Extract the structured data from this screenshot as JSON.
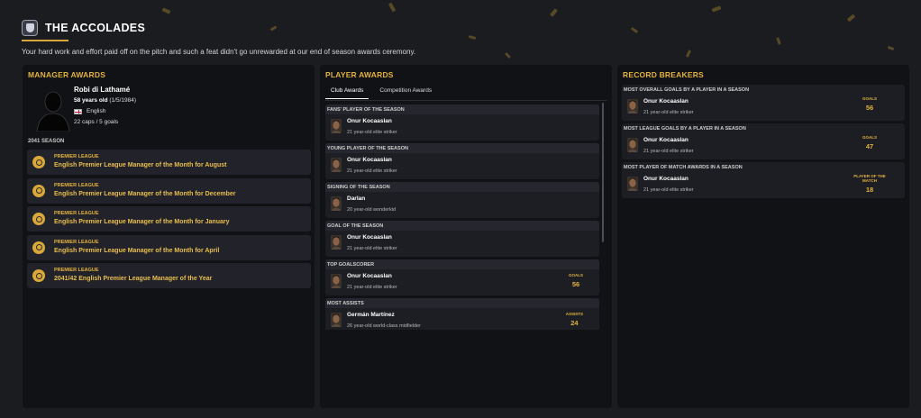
{
  "header": {
    "title": "THE ACCOLADES",
    "subtitle": "Your hard work and effort paid off on the pitch and such a feat didn't go unrewarded at our end of season awards ceremony."
  },
  "colors": {
    "accent": "#e3b33c",
    "panel": "#111216",
    "background": "#1b1c20"
  },
  "manager": {
    "panel_title": "MANAGER AWARDS",
    "name": "Robi di Lathamé",
    "age": "58 years old",
    "dob": "(1/5/1984)",
    "nationality": "English",
    "caps": "22 caps / 5 goals",
    "season": "2041 SEASON",
    "awards": [
      {
        "competition": "PREMIER LEAGUE",
        "name": "English Premier League Manager of the Month for August",
        "icon": "trophy-icon"
      },
      {
        "competition": "PREMIER LEAGUE",
        "name": "English Premier League Manager of the Month for December",
        "icon": "trophy-icon"
      },
      {
        "competition": "PREMIER LEAGUE",
        "name": "English Premier League Manager of the Month for January",
        "icon": "trophy-icon"
      },
      {
        "competition": "PREMIER LEAGUE",
        "name": "English Premier League Manager of the Month for April",
        "icon": "trophy-icon"
      },
      {
        "competition": "PREMIER LEAGUE",
        "name": "2041/42 English Premier League Manager of the Year",
        "icon": "trophy-icon"
      }
    ]
  },
  "player_awards": {
    "panel_title": "PLAYER AWARDS",
    "tabs": [
      "Club Awards",
      "Competition Awards"
    ],
    "active_tab": "Club Awards",
    "cards": [
      {
        "award": "FANS' PLAYER OF THE SEASON",
        "player": "Onur Kocaaslan",
        "desc": "21 year-old elite striker",
        "stat_label": "",
        "stat_value": ""
      },
      {
        "award": "YOUNG PLAYER OF THE SEASON",
        "player": "Onur Kocaaslan",
        "desc": "21 year-old elite striker",
        "stat_label": "",
        "stat_value": ""
      },
      {
        "award": "SIGNING OF THE SEASON",
        "player": "Darlan",
        "desc": "20 year-old wonderkid",
        "stat_label": "",
        "stat_value": ""
      },
      {
        "award": "GOAL OF THE SEASON",
        "player": "Onur Kocaaslan",
        "desc": "21 year-old elite striker",
        "stat_label": "",
        "stat_value": ""
      },
      {
        "award": "TOP GOALSCORER",
        "player": "Onur Kocaaslan",
        "desc": "21 year-old elite striker",
        "stat_label": "GOALS",
        "stat_value": "56"
      },
      {
        "award": "MOST ASSISTS",
        "player": "Germán Martínez",
        "desc": "26 year-old world-class midfielder",
        "stat_label": "ASSISTS",
        "stat_value": "24"
      }
    ]
  },
  "record_breakers": {
    "panel_title": "RECORD BREAKERS",
    "cards": [
      {
        "record": "MOST OVERALL GOALS BY A PLAYER IN A SEASON",
        "player": "Onur Kocaaslan",
        "desc": "21 year-old elite striker",
        "stat_label": "GOALS",
        "stat_value": "56"
      },
      {
        "record": "MOST LEAGUE GOALS BY A PLAYER IN A SEASON",
        "player": "Onur Kocaaslan",
        "desc": "21 year-old elite striker",
        "stat_label": "GOALS",
        "stat_value": "47"
      },
      {
        "record": "MOST PLAYER OF MATCH AWARDS IN A SEASON",
        "player": "Onur Kocaaslan",
        "desc": "21 year-old elite striker",
        "stat_label": "PLAYER OF THE MATCH",
        "stat_value": "18"
      }
    ]
  }
}
